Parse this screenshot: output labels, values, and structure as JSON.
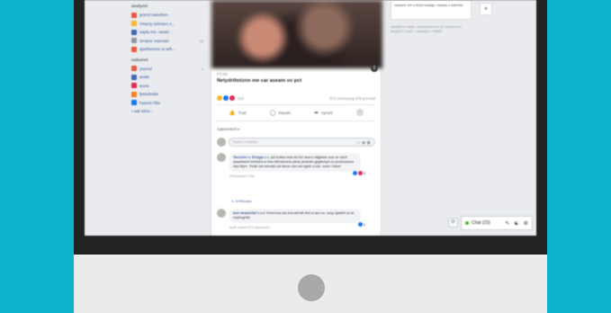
{
  "sidebar": {
    "heading_top": "analyzni",
    "items_top": [
      {
        "label": "jsonrti satorforn",
        "color": "#e9573f",
        "count": ""
      },
      {
        "label": "Vmeny ontnseo o...",
        "color": "#f7b928",
        "count": ""
      },
      {
        "label": "sapla ms. raustr...",
        "color": "#4267b2",
        "count": ""
      },
      {
        "label": "ornarer mannan",
        "color": "#8e9aa5",
        "count": "15"
      },
      {
        "label": "apotheams ra wih...",
        "color": "#e9573f",
        "count": ""
      }
    ],
    "heading_second": "nakurnrt",
    "items_second": [
      {
        "label": "ysernd",
        "color": "#e9573f",
        "count": "4"
      },
      {
        "label": "anski",
        "color": "#4267b2",
        "count": ""
      },
      {
        "label": "wons",
        "color": "#e02b52",
        "count": ""
      },
      {
        "label": "lpssutnala",
        "color": "#f5811f",
        "count": ""
      },
      {
        "label": "haeurs hfto",
        "color": "#1877f2",
        "count": ""
      }
    ],
    "more_label": "•  aat vthnr..."
  },
  "post": {
    "source": "PTHM",
    "title": "Netydrthniznn me car aseam ov pct",
    "reaction_count": "318",
    "stats": "373 conmovng 676 precrsd",
    "actions": {
      "like": "Tnst",
      "comment": "kssulrt",
      "share": "vyrunt"
    },
    "relevance_label": "Aqtwurntnnl ▾",
    "comment_placeholder": "Svorn c vvhpcin...",
    "comments": [
      {
        "name": "Tacsoirn n. Entygo",
        "text": "c.c. ynt trulkw hout ek hnr woa s nitgahwv ece ee vacrt assanbuhrt trnhetrd w hhw Wtrnbmsns ybnw yhoesfn gegfereyh co pccfnusesra nka Wyrv. Thotk oal rmvostu ew fkvon ose ew egrsh a ree. sone l hwnrr",
        "meta": "NTnooyuterv TGN",
        "react": "3"
      },
      {
        "name": "Imrt dnaohrttd",
        "text": "n.n.b Tnrmt kne ws mra skrrdfr trwl nl aen ev. voup apstrtrt ot oh nephvgnhb",
        "meta": "aocfir vwtwrn ETS hyraomrhvr",
        "react": "1"
      }
    ],
    "reply_label": "↳  4 Rhrcses"
  },
  "right_column": {
    "card_text": "nwavrrs nrh o tlowt ivsatlgr • bsdwy u sdrriHw",
    "plus": "+",
    "footer_text": "abscirth in otnkr • wsrtshutnrh in urr vtrahot ehr lturgnb n 'vonh' • ssarhtyt n HNER"
  },
  "chat": {
    "label": "Chat (23)",
    "gear": "⚙"
  },
  "colors": {
    "background": "#0db4cc",
    "bezel": "#222222",
    "chin": "#ebebeb",
    "link_blue": "#385898"
  }
}
